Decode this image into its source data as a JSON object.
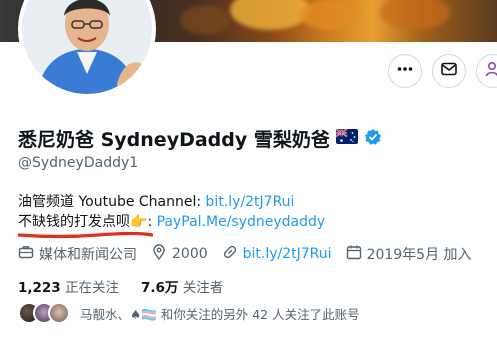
{
  "profile": {
    "display_name": "悉尼奶爸 SydneyDaddy 雪梨奶爸",
    "handle": "@SydneyDaddy1",
    "flag_icon": "australia-flag-icon",
    "verified_color": "#1d9bf0"
  },
  "actions": {
    "more_icon": "more-icon",
    "message_icon": "mail-icon",
    "follow_icon": "person-add-icon"
  },
  "bio": {
    "line1_text": "油管频道 Youtube Channel: ",
    "line1_link": "bit.ly/2tJ7Rui",
    "line2_text": "不缺钱的打发点呗",
    "line2_emoji": "👉",
    "line2_colon": ":",
    "line2_link": "PayPal.Me/sydneydaddy"
  },
  "meta": {
    "category": "媒体和新闻公司",
    "location": "2000",
    "website": "bit.ly/2tJ7Rui",
    "joined": "2019年5月 加入"
  },
  "stats": {
    "following_count": "1,223",
    "following_label": "正在关注",
    "followers_count": "7.6万",
    "followers_label": "关注者"
  },
  "followed_by": {
    "text": "马靓水、♠🏳️‍⚧️ 和你关注的另外 42 人关注了此账号"
  },
  "colors": {
    "link": "#1d9bf0",
    "secondary_text": "#536471",
    "follow_button": "#8e44ad"
  }
}
